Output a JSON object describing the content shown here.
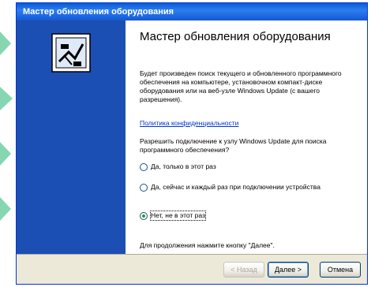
{
  "window": {
    "title": "Мастер обновления оборудования"
  },
  "content": {
    "heading": "Мастер обновления оборудования",
    "intro": "Будет произведен поиск текущего и обновленного программного обеспечения на компьютере, установочном компакт-диске оборудования или на веб-узле Windows Update (с вашего разрешения).",
    "privacy_link": "Политика конфиденциальности",
    "question": "Разрешить подключение к узлу Windows Update для поиска программного обеспечения?",
    "options": [
      {
        "label": "Да, только в этот раз",
        "checked": false
      },
      {
        "label": "Да, сейчас и каждый раз при подключении устройства",
        "checked": false
      },
      {
        "label": "Нет, не в этот раз",
        "checked": true
      }
    ],
    "continue_text": "Для продолжения нажмите кнопку \"Далее\"."
  },
  "buttons": {
    "back": "< Назад",
    "next": "Далее >",
    "cancel": "Отмена"
  },
  "icons": {
    "wizard": "hardware-wizard-icon"
  },
  "colors": {
    "title_bar": "#1558d2",
    "left_panel": "#1c4fb4",
    "dialog_bg": "#ece9d8",
    "link": "#0033cc",
    "deco_green": "#22b573"
  }
}
